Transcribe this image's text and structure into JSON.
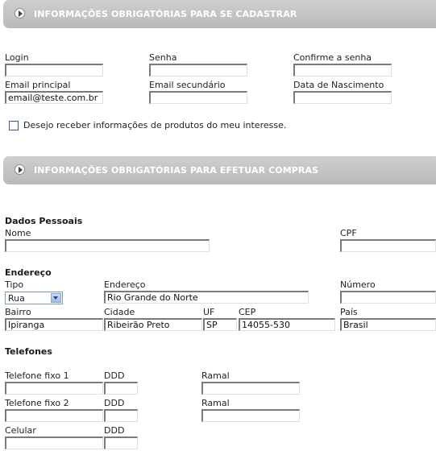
{
  "section1": {
    "title": "INFORMAÇÕES OBRIGATÓRIAS PARA SE CADASTRAR"
  },
  "section2": {
    "title": "INFORMAÇÕES OBRIGATÓRIAS PARA EFETUAR COMPRAS"
  },
  "account": {
    "login_label": "Login",
    "login_value": "",
    "senha_label": "Senha",
    "senha_value": "",
    "confirme_label": "Confirme a senha",
    "confirme_value": "",
    "email_principal_label": "Email principal",
    "email_principal_value": "email@teste.com.br",
    "email_secundario_label": "Email secundário",
    "email_secundario_value": "",
    "nascimento_label": "Data de Nascimento",
    "nascimento_value": ""
  },
  "newsletter": {
    "label": "Desejo receber informações de produtos do meu interesse.",
    "checked": false
  },
  "pessoais": {
    "heading": "Dados Pessoais",
    "nome_label": "Nome",
    "nome_value": "",
    "cpf_label": "CPF",
    "cpf_value": ""
  },
  "endereco": {
    "heading": "Endereço",
    "tipo_label": "Tipo",
    "tipo_value": "Rua",
    "endereco_label": "Endereço",
    "endereco_value": "Rio Grande do Norte",
    "numero_label": "Número",
    "numero_value": "",
    "bairro_label": "Bairro",
    "bairro_value": "Ipiranga",
    "cidade_label": "Cidade",
    "cidade_value": "Ribeirão Preto",
    "uf_label": "UF",
    "uf_value": "SP",
    "cep_label": "CEP",
    "cep_value": "14055-530",
    "pais_label": "País",
    "pais_value": "Brasil"
  },
  "telefones": {
    "heading": "Telefones",
    "fixo1_label": "Telefone fixo 1",
    "fixo2_label": "Telefone fixo 2",
    "celular_label": "Celular",
    "ddd_label": "DDD",
    "ramal_label": "Ramal"
  }
}
